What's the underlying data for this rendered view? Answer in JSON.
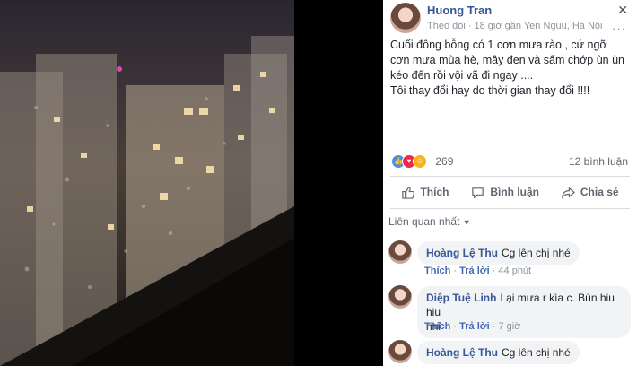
{
  "post": {
    "author": "Huong Tran",
    "follow": "Theo dõi",
    "time": "18 giờ",
    "location": "gần Yen Nguu, Hà Nội",
    "text_lines": [
      "Cuối đông bỗng có 1 cơn mưa rào , cứ ngỡ cơn mưa mùa hè, mây đen và sấm chớp ùn ùn kéo đến rồi vội vã đi ngay ....",
      "Tôi thay đổi hay do thời gian thay đổi !!!!"
    ],
    "reaction_count": "269",
    "comment_count": "12 bình luận"
  },
  "actions": {
    "like": "Thích",
    "comment": "Bình luận",
    "share": "Chia sẻ"
  },
  "sort_label": "Liên quan nhất",
  "comments": [
    {
      "name": "Hoàng Lệ Thu",
      "text": "Cg lên chị nhé",
      "like": "Thích",
      "reply": "Trả lời",
      "time": "44 phút"
    },
    {
      "name": "Diệp Tuệ Linh",
      "text_line1": "Lại mưa r kìa c. Bùn hiu hiu",
      "text_line2": "nhỉ",
      "like": "Thích",
      "reply": "Trả lời",
      "time": "7 giờ"
    },
    {
      "name": "Hoàng Lệ Thu",
      "text": "Cg lên chị nhé"
    }
  ],
  "icons": [
    "close-icon",
    "more-icon",
    "like-icon",
    "comment-icon",
    "share-icon",
    "chevron-down-icon"
  ],
  "colors": {
    "link": "#365899",
    "meta": "#90949c",
    "bubble": "#f2f3f5"
  }
}
